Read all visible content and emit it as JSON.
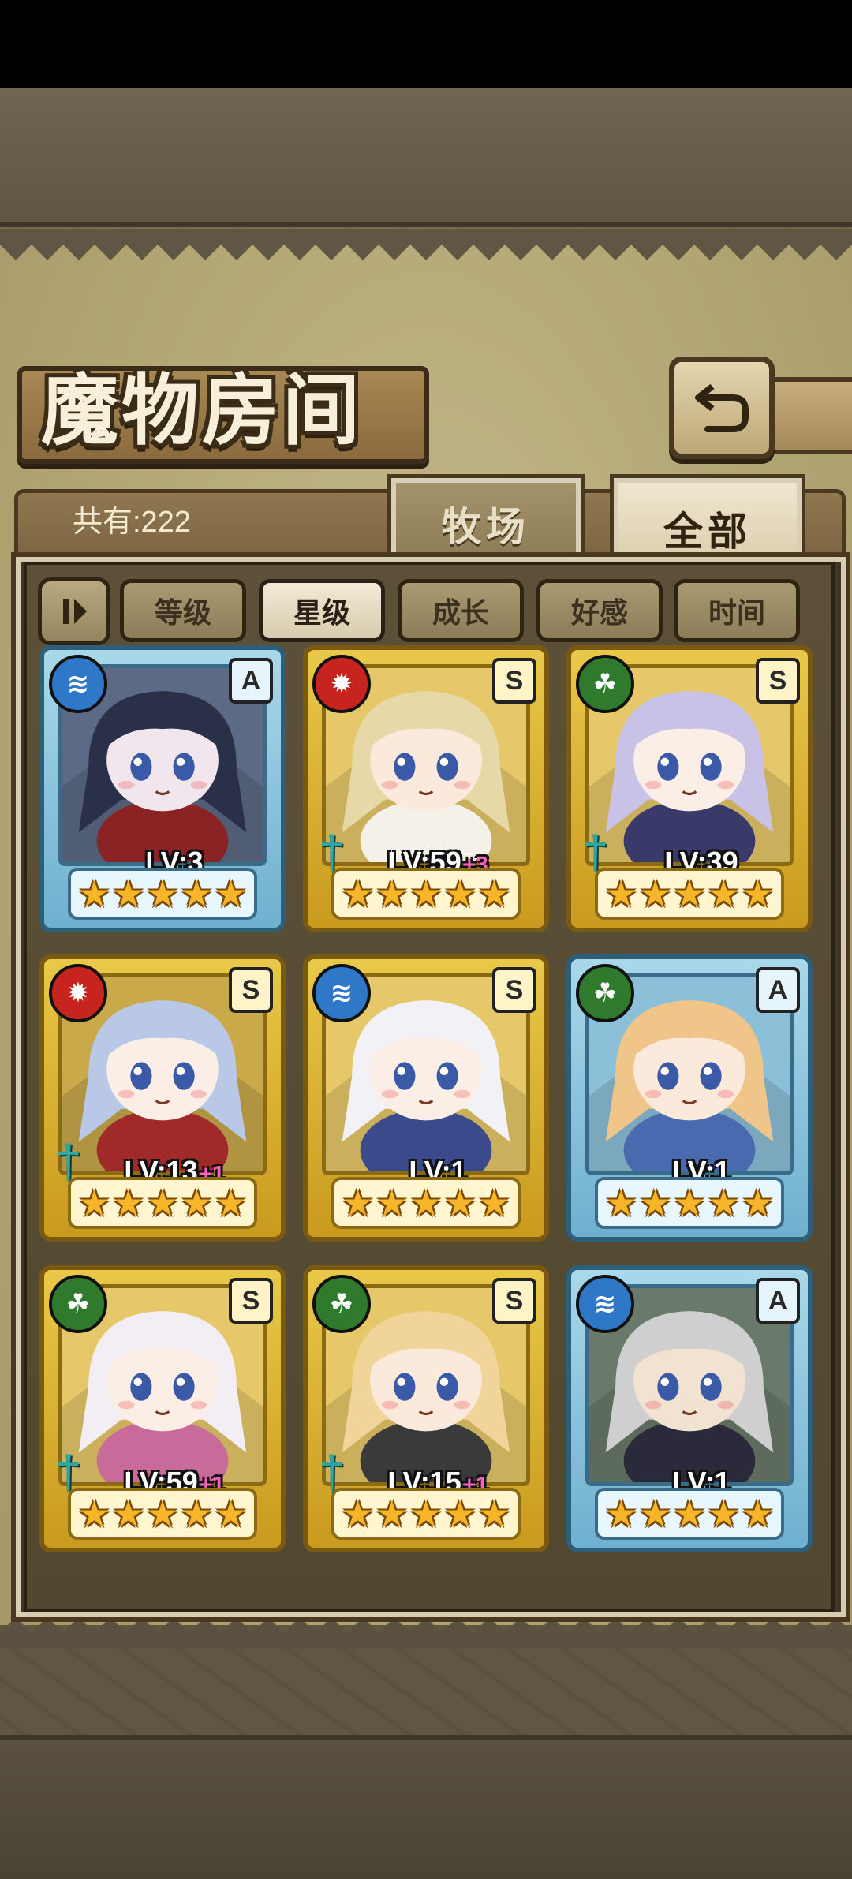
{
  "header": {
    "title": "魔物房间",
    "total_label": "共有:222"
  },
  "tabs": [
    {
      "label": "牧场",
      "active": false
    },
    {
      "label": "全部",
      "active": true
    }
  ],
  "sort_buttons": [
    {
      "label": "等级",
      "active": false
    },
    {
      "label": "星级",
      "active": true
    },
    {
      "label": "成长",
      "active": false
    },
    {
      "label": "好感",
      "active": false
    },
    {
      "label": "时间",
      "active": false
    }
  ],
  "monsters": [
    {
      "element": "water",
      "element_icon": "water-icon",
      "rank": "A",
      "frame": "blue",
      "level": "LV:3",
      "bonus": "",
      "weapon": false,
      "stars": 5,
      "palette": {
        "hair": "#2a3048",
        "skin": "#f2e6ee",
        "accent": "#8a2323",
        "bg": "#5d6a86"
      }
    },
    {
      "element": "fire",
      "element_icon": "flame-icon",
      "rank": "S",
      "frame": "gold",
      "level": "LV:59",
      "bonus": "+3",
      "weapon": true,
      "stars": 5,
      "palette": {
        "hair": "#e7d8a8",
        "skin": "#fbe9dc",
        "accent": "#f4f1e8",
        "bg": "#e6c86a"
      }
    },
    {
      "element": "wood",
      "element_icon": "leaf-icon",
      "rank": "S",
      "frame": "gold",
      "level": "LV:39",
      "bonus": "",
      "weapon": true,
      "stars": 5,
      "palette": {
        "hair": "#c8c2e6",
        "skin": "#fbeee6",
        "accent": "#3a3a6a",
        "bg": "#e6c86a"
      }
    },
    {
      "element": "fire",
      "element_icon": "flame-icon",
      "rank": "S",
      "frame": "gold",
      "level": "LV:13",
      "bonus": "+1",
      "weapon": true,
      "stars": 5,
      "palette": {
        "hair": "#b8c8e6",
        "skin": "#fbeee6",
        "accent": "#a02a2a",
        "bg": "#c9a94a"
      }
    },
    {
      "element": "water",
      "element_icon": "water-icon",
      "rank": "S",
      "frame": "gold",
      "level": "LV:1",
      "bonus": "",
      "weapon": false,
      "stars": 5,
      "palette": {
        "hair": "#f2f2f6",
        "skin": "#fbeee6",
        "accent": "#3a4a8a",
        "bg": "#e6c86a"
      }
    },
    {
      "element": "wood",
      "element_icon": "leaf-icon",
      "rank": "A",
      "frame": "blue",
      "level": "LV:1",
      "bonus": "",
      "weapon": false,
      "stars": 5,
      "palette": {
        "hair": "#f0c58a",
        "skin": "#fbe9dc",
        "accent": "#4a6ab0",
        "bg": "#8cc0d8"
      }
    },
    {
      "element": "wood",
      "element_icon": "leaf-icon",
      "rank": "S",
      "frame": "gold",
      "level": "LV:59",
      "bonus": "+1",
      "weapon": true,
      "stars": 5,
      "palette": {
        "hair": "#f3eef4",
        "skin": "#fbeee6",
        "accent": "#c86a9a",
        "bg": "#e6c86a"
      }
    },
    {
      "element": "wood",
      "element_icon": "leaf-icon",
      "rank": "S",
      "frame": "gold",
      "level": "LV:15",
      "bonus": "+1",
      "weapon": true,
      "stars": 5,
      "palette": {
        "hair": "#f1d49a",
        "skin": "#fbe9dc",
        "accent": "#3a3a3a",
        "bg": "#e6c86a"
      }
    },
    {
      "element": "water",
      "element_icon": "water-icon",
      "rank": "A",
      "frame": "blue",
      "level": "LV:1",
      "bonus": "",
      "weapon": false,
      "stars": 5,
      "palette": {
        "hair": "#cfcfcf",
        "skin": "#f2e2d2",
        "accent": "#2a2a3a",
        "bg": "#6a7a6a"
      }
    }
  ]
}
